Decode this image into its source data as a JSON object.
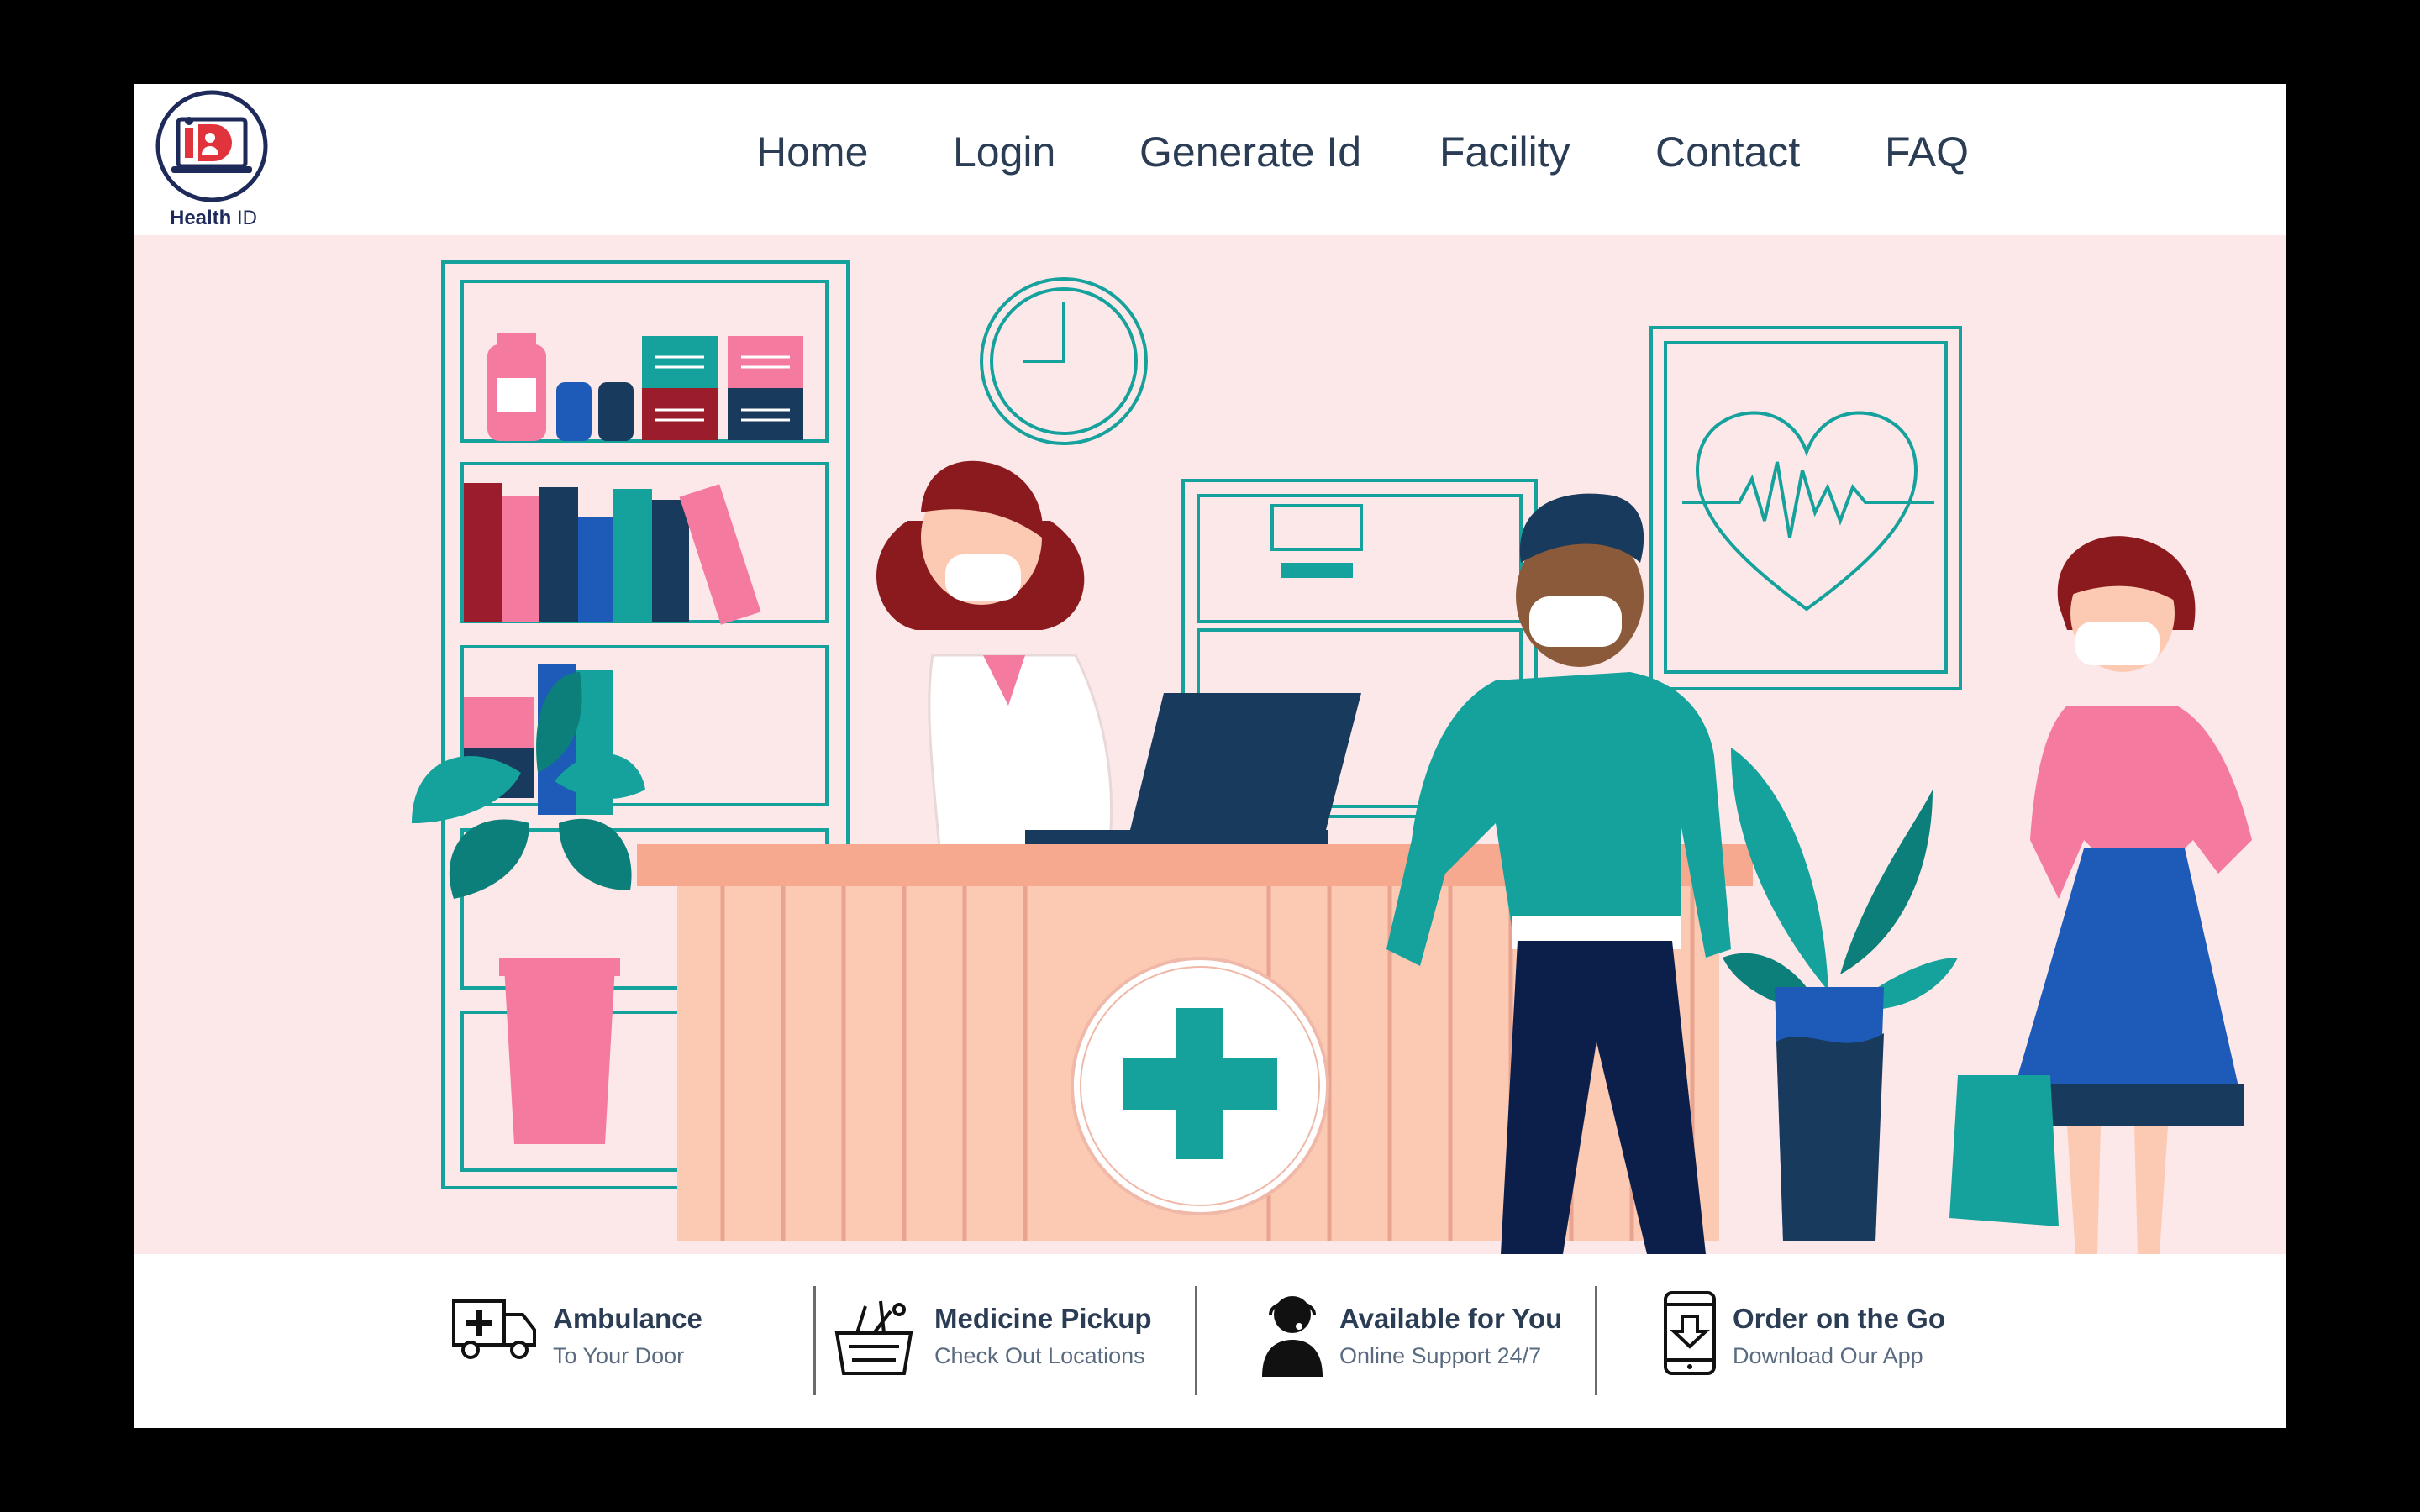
{
  "header": {
    "logo_text_bold": "Health",
    "logo_text_regular": "ID",
    "logo_mark": "iD",
    "nav": [
      {
        "label": "Home"
      },
      {
        "label": "Login"
      },
      {
        "label": "Generate Id"
      },
      {
        "label": "Facility"
      },
      {
        "label": "Contact"
      },
      {
        "label": "FAQ"
      }
    ]
  },
  "hero": {
    "illustration": "medical-reception-desk",
    "colors": {
      "background": "#fce8e8",
      "teal": "#15a19c",
      "navy": "#183a5c",
      "pink": "#f47aa0",
      "desk": "#fcc9b3"
    }
  },
  "features": [
    {
      "icon": "ambulance-icon",
      "title": "Ambulance",
      "subtitle": "To Your Door"
    },
    {
      "icon": "medicine-basket-icon",
      "title": "Medicine Pickup",
      "subtitle": "Check Out Locations"
    },
    {
      "icon": "support-agent-icon",
      "title": "Available for You",
      "subtitle": "Online Support 24/7"
    },
    {
      "icon": "phone-download-icon",
      "title": "Order on the Go",
      "subtitle": "Download Our App"
    }
  ]
}
